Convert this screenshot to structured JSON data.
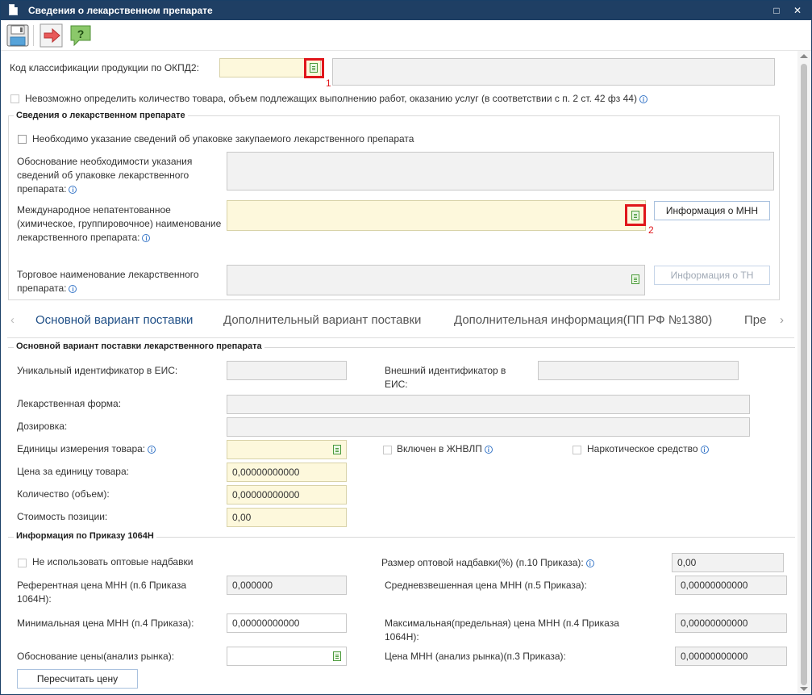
{
  "window": {
    "title": "Сведения о лекарственном препарате",
    "maximize_glyph": "□",
    "close_glyph": "✕"
  },
  "toolbar": {
    "icons": [
      "save-icon",
      "forward-arrow-icon",
      "help-icon"
    ]
  },
  "okpd": {
    "label": "Код классификации продукции по ОКПД2:",
    "code_value": "",
    "name_value": "",
    "marker": "1"
  },
  "impossible_qty": {
    "label": "Невозможно определить количество товара, объем подлежащих выполнению работ, оказанию услуг (в соответствии с п. 2 ст. 42 фз 44)",
    "checked": false
  },
  "drug_info": {
    "section_title": "Сведения о лекарственном препарате",
    "package_checkbox_label": "Необходимо указание сведений об упаковке закупаемого лекарственного препарата",
    "package_checked": false,
    "justification_label": "Обоснование необходимости указания сведений об упаковке лекарственного препарата:",
    "justification_value": "",
    "inn_label": "Международное непатентованное (химическое, группировочное) наименование лекарственного препарата:",
    "inn_value": "",
    "inn_button": "Информация о МНН",
    "marker": "2",
    "trade_label": "Торговое наименование лекарственного препарата:",
    "trade_value": "",
    "trade_button": "Информация о ТН"
  },
  "tabs": [
    {
      "label": "Основной вариант поставки",
      "active": true
    },
    {
      "label": "Дополнительный вариант поставки",
      "active": false
    },
    {
      "label": "Дополнительная информация(ПП РФ №1380)",
      "active": false
    },
    {
      "label": "Пре",
      "active": false
    }
  ],
  "tab_arrows": {
    "left": "‹",
    "right": "›"
  },
  "main_variant": {
    "section_title": "Основной вариант поставки лекарственного препарата",
    "eis_id_label": "Уникальный идентификатор в ЕИС:",
    "eis_id_value": "",
    "ext_id_label": "Внешний идентификатор в ЕИС:",
    "ext_id_value": "",
    "form_label": "Лекарственная форма:",
    "form_value": "",
    "dosage_label": "Дозировка:",
    "dosage_value": "",
    "units_label": "Единицы измерения товара:",
    "units_value": "",
    "zhnvlp_label": "Включен в ЖНВЛП",
    "zhnvlp_checked": false,
    "narcotic_label": "Наркотическое средство",
    "narcotic_checked": false,
    "price_label": "Цена за единицу товара:",
    "price_value": "0,00000000000",
    "qty_label": "Количество (объем):",
    "qty_value": "0,00000000000",
    "cost_label": "Стоимость позиции:",
    "cost_value": "0,00"
  },
  "order_1064": {
    "section_title": "Информация по Приказу 1064Н",
    "no_markup_label": "Не использовать оптовые надбавки",
    "no_markup_checked": false,
    "markup_label": "Размер оптовой надбавки(%) (п.10 Приказа):",
    "markup_value": "0,00",
    "ref_price_label": "Референтная цена МНН (п.6 Приказа 1064Н):",
    "ref_price_value": "0,000000",
    "avg_price_label": "Средневзвешенная цена МНН (п.5 Приказа):",
    "avg_price_value": "0,00000000000",
    "min_price_label": "Минимальная цена МНН (п.4 Приказа):",
    "min_price_value": "0,00000000000",
    "max_price_label": "Максимальная(предельная) цена МНН (п.4 Приказа 1064Н):",
    "max_price_value": "0,00000000000",
    "justify_label": "Обоснование цены(анализ рынка):",
    "justify_value": "",
    "market_price_label": "Цена МНН (анализ рынка)(п.3 Приказа):",
    "market_price_value": "0,00000000000",
    "recalc_button": "Пересчитать цену"
  },
  "info_glyph": "i",
  "colors": {
    "titlebar": "#1f3f64",
    "required_field": "#fdf8dc",
    "readonly_field": "#f2f2f2",
    "accent_tab": "#1e4e86",
    "annotation_red": "#e0161b"
  }
}
